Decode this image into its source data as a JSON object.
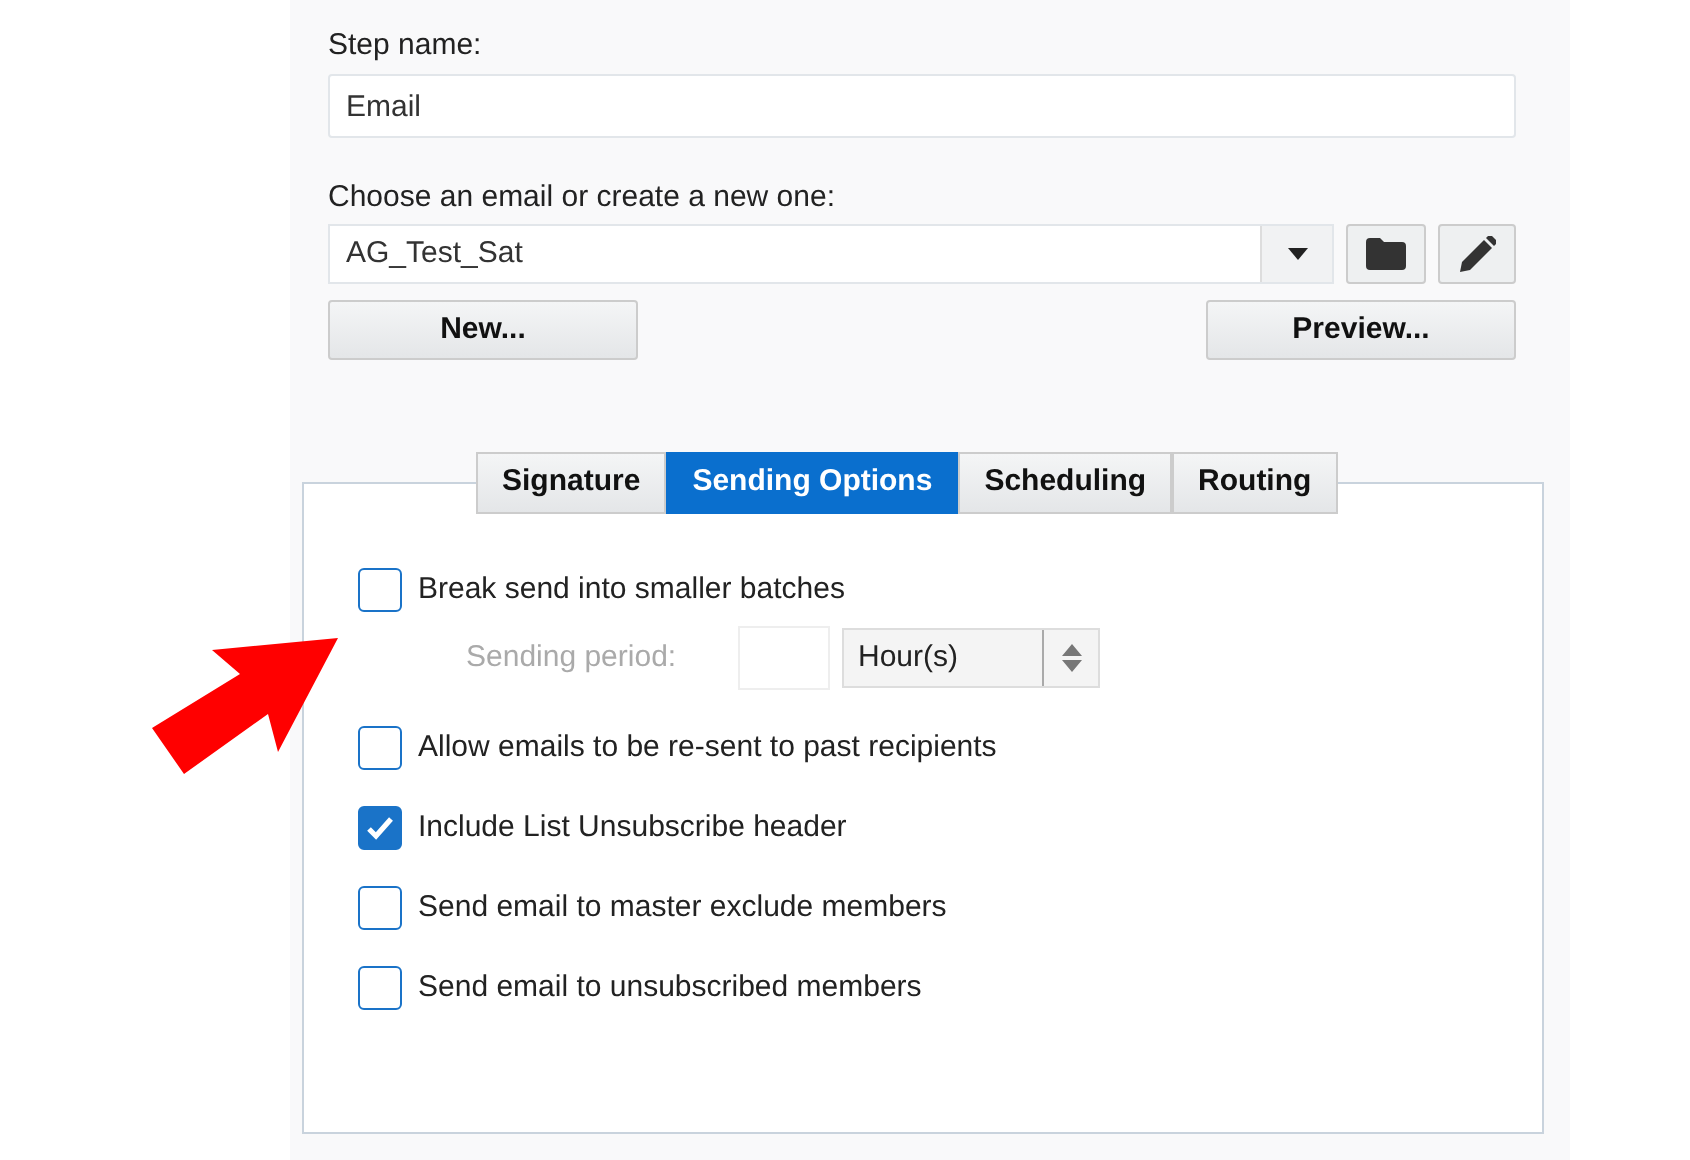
{
  "step_name": {
    "label": "Step name:",
    "value": "Email"
  },
  "email_chooser": {
    "label": "Choose an email or create a new one:",
    "value": "AG_Test_Sat"
  },
  "buttons": {
    "new": "New...",
    "preview": "Preview..."
  },
  "tabs": [
    {
      "label": "Signature",
      "selected": false
    },
    {
      "label": "Sending Options",
      "selected": true
    },
    {
      "label": "Scheduling",
      "selected": false
    },
    {
      "label": "Routing",
      "selected": false
    }
  ],
  "options": [
    {
      "kind": "checkbox",
      "label": "Break send into smaller batches",
      "checked": false
    },
    {
      "kind": "period",
      "label": "Sending period:",
      "unit": "Hour(s)",
      "disabled": true
    },
    {
      "kind": "checkbox",
      "label": "Allow emails to be re-sent to past recipients",
      "checked": false
    },
    {
      "kind": "checkbox",
      "label": "Include List Unsubscribe header",
      "checked": true
    },
    {
      "kind": "checkbox",
      "label": "Send email to master exclude members",
      "checked": false
    },
    {
      "kind": "checkbox",
      "label": "Send email to unsubscribed members",
      "checked": false
    }
  ]
}
